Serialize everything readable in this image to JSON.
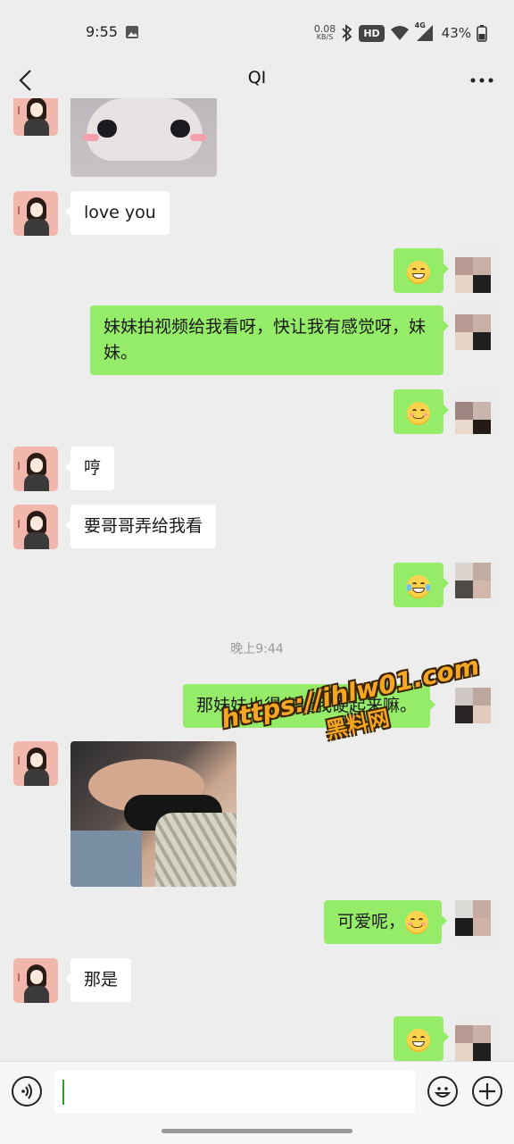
{
  "status_bar": {
    "time": "9:55",
    "net_speed_value": "0.08",
    "net_speed_unit": "KB/S",
    "hd_label": "HD",
    "network_label": "4G",
    "battery": "43%"
  },
  "nav": {
    "title": "QI"
  },
  "messages": [
    {
      "from": "her",
      "type": "image",
      "content": "cat-sticker"
    },
    {
      "from": "her",
      "type": "text",
      "text": "love you"
    },
    {
      "from": "me",
      "type": "emoji",
      "emoji": "grin"
    },
    {
      "from": "me",
      "type": "text",
      "text": "妹妹拍视频给我看呀，快让我有感觉呀，妹妹。"
    },
    {
      "from": "me",
      "type": "emoji",
      "emoji": "smile"
    },
    {
      "from": "her",
      "type": "text",
      "text": "哼"
    },
    {
      "from": "her",
      "type": "text",
      "text": "要哥哥弄给我看"
    },
    {
      "from": "me",
      "type": "emoji",
      "emoji": "tears-of-joy"
    },
    {
      "type": "timestamp",
      "text": "晚上9:44"
    },
    {
      "from": "me",
      "type": "text",
      "text": "那妹妹也得先让我硬起来嘛。"
    },
    {
      "from": "her",
      "type": "image",
      "content": "photo"
    },
    {
      "from": "me",
      "type": "text",
      "text": "可爱呢，"
    },
    {
      "from": "her",
      "type": "text",
      "text": "那是"
    },
    {
      "from": "me",
      "type": "emoji",
      "emoji": "grin"
    }
  ],
  "watermark": {
    "line1": "https://ihlw01.com",
    "line2": "黑料网"
  },
  "colors": {
    "outgoing_bubble": "#95ec69",
    "incoming_bubble": "#ffffff",
    "background": "#ededed"
  }
}
